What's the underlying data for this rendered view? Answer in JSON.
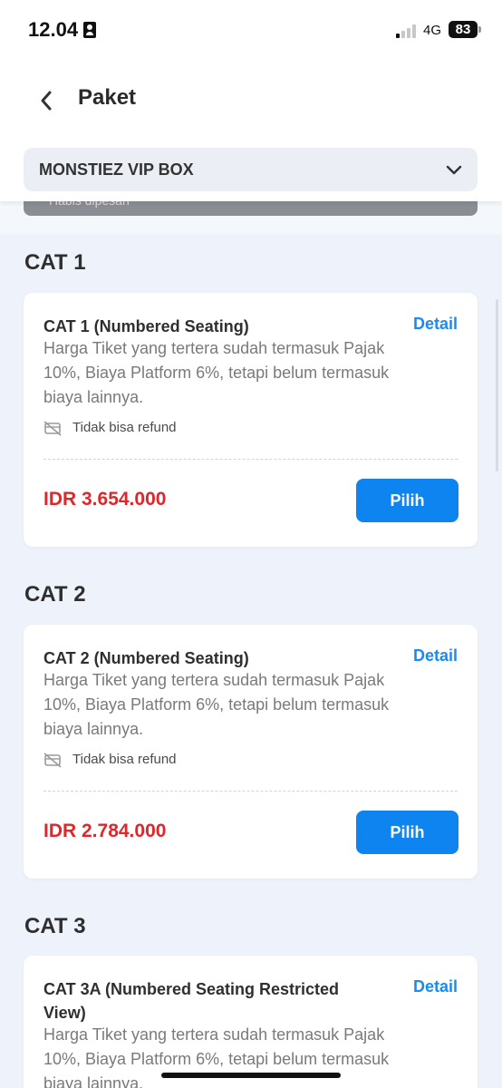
{
  "status_bar": {
    "time": "12.04",
    "network": "4G",
    "battery": "83"
  },
  "header": {
    "title": "Paket"
  },
  "dropdown": {
    "selected": "MONSTIEZ VIP BOX"
  },
  "sold_out": {
    "text": "Habis dipesan"
  },
  "sections": [
    {
      "title": "CAT 1",
      "card": {
        "name": "CAT 1 (Numbered Seating)",
        "detail_label": "Detail",
        "description": "Harga Tiket yang tertera sudah termasuk Pajak 10%, Biaya Platform 6%, tetapi belum termasuk biaya lainnya.",
        "refund": "Tidak bisa refund",
        "price": "IDR 3.654.000",
        "button": "Pilih"
      }
    },
    {
      "title": "CAT 2",
      "card": {
        "name": "CAT 2 (Numbered Seating)",
        "detail_label": "Detail",
        "description": "Harga Tiket yang tertera sudah termasuk Pajak 10%, Biaya Platform 6%, tetapi belum termasuk biaya lainnya.",
        "refund": "Tidak bisa refund",
        "price": "IDR 2.784.000",
        "button": "Pilih"
      }
    },
    {
      "title": "CAT 3",
      "card": {
        "name": "CAT 3A (Numbered Seating Restricted View)",
        "detail_label": "Detail",
        "description": "Harga Tiket yang tertera sudah termasuk Pajak 10%, Biaya Platform 6%, tetapi belum termasuk biaya lainnya."
      }
    }
  ],
  "colors": {
    "accent": "#0d84f0",
    "price": "#e0262b",
    "link": "#1a8bf0"
  }
}
